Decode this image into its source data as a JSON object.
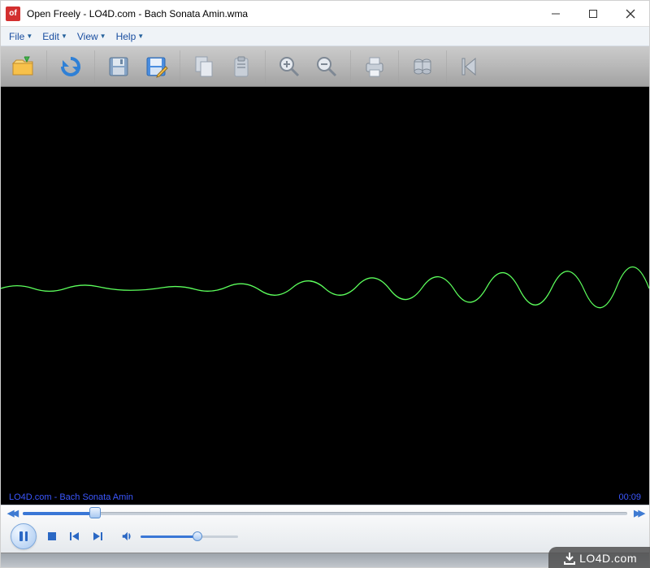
{
  "titlebar": {
    "app_icon_text": "of",
    "title": "Open Freely - LO4D.com - Bach Sonata Amin.wma"
  },
  "menu": {
    "file": "File",
    "edit": "Edit",
    "view": "View",
    "help": "Help"
  },
  "toolbar": {
    "open": "open",
    "refresh": "refresh",
    "save": "save",
    "save_edit": "save-edit",
    "copy": "copy",
    "paste": "paste",
    "zoom_in": "zoom-in",
    "zoom_out": "zoom-out",
    "print": "print",
    "properties": "properties",
    "prev": "prev"
  },
  "status": {
    "track": "LO4D.com - Bach Sonata Amin",
    "time": "00:09"
  },
  "player": {
    "seek_percent": 12,
    "volume_percent": 58
  },
  "watermark": {
    "text": "LO4D.com"
  }
}
